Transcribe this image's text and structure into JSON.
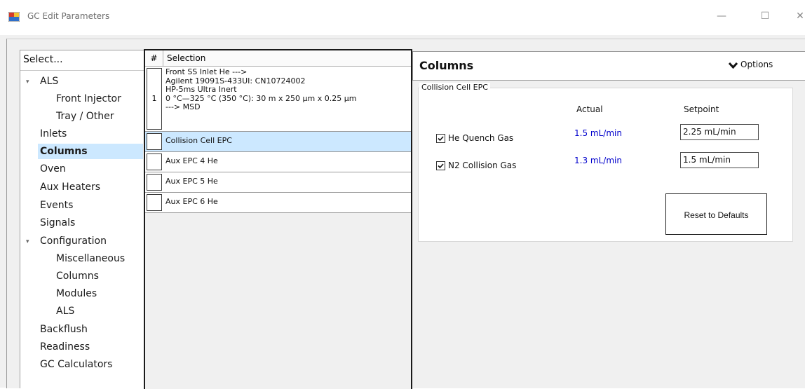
{
  "window": {
    "title": "GC Edit Parameters",
    "minimize": "—",
    "maximize": "☐",
    "close": "✕"
  },
  "tree": {
    "header": "Select...",
    "items": [
      {
        "label": "ALS",
        "expander": "▾"
      },
      {
        "label": "Front Injector"
      },
      {
        "label": "Tray / Other"
      },
      {
        "label": "Inlets"
      },
      {
        "label": "Columns",
        "selected": true
      },
      {
        "label": "Oven"
      },
      {
        "label": "Aux Heaters"
      },
      {
        "label": "Events"
      },
      {
        "label": "Signals"
      },
      {
        "label": "Configuration",
        "expander": "▾"
      },
      {
        "label": "Miscellaneous"
      },
      {
        "label": "Columns"
      },
      {
        "label": "Modules"
      },
      {
        "label": "ALS"
      },
      {
        "label": "Backflush"
      },
      {
        "label": "Readiness"
      },
      {
        "label": "GC Calculators"
      }
    ]
  },
  "grid": {
    "col_num": "#",
    "col_selection": "Selection",
    "rows": [
      {
        "num": "1",
        "lines": [
          "Front SS Inlet He --->",
          "Agilent 19091S-433UI: CN10724002",
          "HP-5ms Ultra Inert",
          "0 °C—325 °C (350 °C): 30 m x 250 µm x 0.25 µm",
          "---> MSD"
        ]
      },
      {
        "num": "",
        "lines": [
          "Collision Cell EPC"
        ],
        "selected": true
      },
      {
        "num": "",
        "lines": [
          "Aux EPC 4 He"
        ]
      },
      {
        "num": "",
        "lines": [
          "Aux EPC 5 He"
        ]
      },
      {
        "num": "",
        "lines": [
          "Aux EPC 6 He"
        ]
      }
    ]
  },
  "panel": {
    "title": "Columns",
    "options_label": "Options",
    "group_title": "Collision Cell EPC",
    "col_actual": "Actual",
    "col_setpoint": "Setpoint",
    "gases": [
      {
        "label": "He Quench Gas",
        "checked": true,
        "actual": "1.5 mL/min",
        "setpoint": "2.25 mL/min"
      },
      {
        "label": "N2 Collision Gas",
        "checked": true,
        "actual": "1.3 mL/min",
        "setpoint": "1.5 mL/min"
      }
    ],
    "reset_label": "Reset to Defaults"
  },
  "colors": {
    "selection": "#cce8ff",
    "actual_value": "#0000cc"
  }
}
